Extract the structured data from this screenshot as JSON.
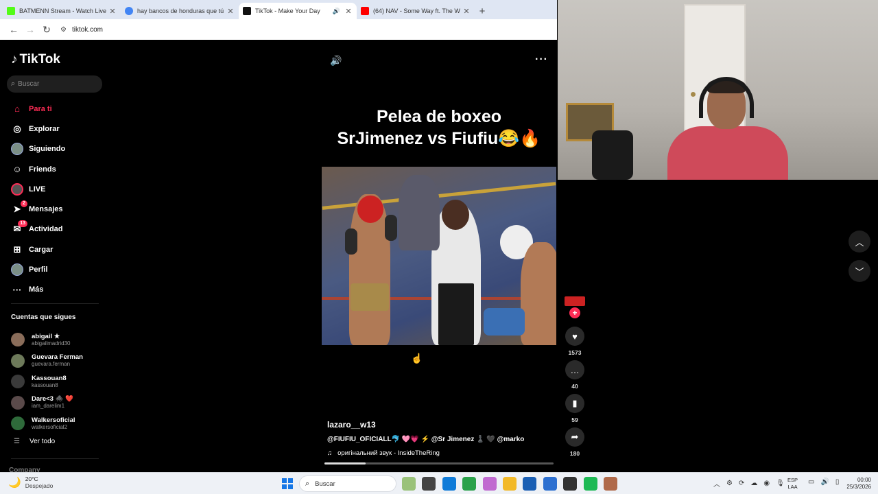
{
  "browser": {
    "tabs": [
      {
        "title": "BATMENN Stream - Watch Live",
        "color": "#53fc18",
        "active": false
      },
      {
        "title": "hay bancos de honduras que tú",
        "color": "#4285f4",
        "active": false
      },
      {
        "title": "TikTok - Make Your Day",
        "color": "#111111",
        "active": true
      },
      {
        "title": "(64) NAV - Some Way ft. The W",
        "color": "#ff0000",
        "active": false
      }
    ],
    "url": "tiktok.com"
  },
  "sidebar": {
    "logo": "TikTok",
    "search_placeholder": "Buscar",
    "nav": [
      {
        "label": "Para ti",
        "icon": "home-icon",
        "glyph": "⌂",
        "active": true
      },
      {
        "label": "Explorar",
        "icon": "compass-icon",
        "glyph": "◎"
      },
      {
        "label": "Siguiendo",
        "icon": "following-avatar-icon",
        "glyph": ""
      },
      {
        "label": "Friends",
        "icon": "friends-icon",
        "glyph": "☺"
      },
      {
        "label": "LIVE",
        "icon": "live-icon",
        "glyph": ""
      },
      {
        "label": "Mensajes",
        "icon": "messages-icon",
        "glyph": "➤",
        "badge": "2"
      },
      {
        "label": "Actividad",
        "icon": "activity-icon",
        "glyph": "✉",
        "badge": "13"
      },
      {
        "label": "Cargar",
        "icon": "upload-icon",
        "glyph": "⊞"
      },
      {
        "label": "Perfil",
        "icon": "profile-avatar-icon",
        "glyph": ""
      },
      {
        "label": "Más",
        "icon": "more-icon",
        "glyph": "···"
      }
    ],
    "following_title": "Cuentas que sigues",
    "accounts": [
      {
        "name": "abigail ★",
        "handle": "abigailmadrid30",
        "color": "#8a6d5a"
      },
      {
        "name": "Guevara Ferman",
        "handle": "guevara.ferman",
        "color": "#6d7a5a"
      },
      {
        "name": "Kassouan8",
        "handle": "kassouan8",
        "color": "#3a3a3a"
      },
      {
        "name": "Dare<3 🕷️ ❤️",
        "handle": "iam_darelim1",
        "color": "#5a4a4a"
      },
      {
        "name": "Walkersoficial",
        "handle": "walkersoficial2",
        "color": "#2e6a3a"
      }
    ],
    "see_all": "Ver todo",
    "company": "Company"
  },
  "video": {
    "title_line1": "Pelea  de boxeo",
    "title_line2": "SrJimenez vs Fiufiu😂🔥",
    "author": "lazaro__w13",
    "description": "@FIUFIU_OFICIALL🐬 🩷💗 ⚡ @Sr Jimenez ♟️ 🖤 @marko",
    "music_prefix": "оригінальний звук",
    "music_sep": " - ",
    "music_artist": "InsideTheRing",
    "progress": 0.18
  },
  "actions": {
    "likes": "1573",
    "comments": "40",
    "saves": "59",
    "shares": "180"
  },
  "taskbar": {
    "temp": "20°C",
    "weather": "Despejado",
    "search": "Buscar",
    "lang1": "ESP",
    "lang2": "LAA",
    "time": "00:00",
    "date": "25/3/2026",
    "apps": [
      "#9ac27a",
      "#444444",
      "#0f7bd8",
      "#2aa14a",
      "#c06ad0",
      "#f2b928",
      "#1a5fb4",
      "#2c6fd0",
      "#333333",
      "#1db954",
      "#b06a4a"
    ]
  }
}
